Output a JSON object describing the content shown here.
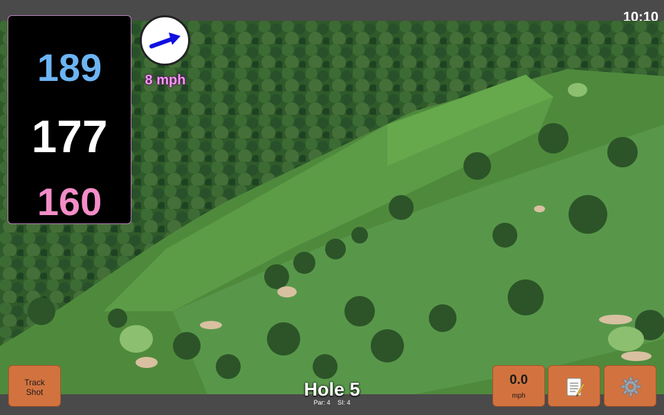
{
  "status_bar": {
    "time": "10:10"
  },
  "distances": {
    "back": "189",
    "middle": "177",
    "front": "160"
  },
  "wind": {
    "speed_label": "8 mph",
    "direction_icon": "arrow-icon",
    "arrow_color": "#1010e0"
  },
  "hole": {
    "title": "Hole 5",
    "par_label": "Par: 4",
    "si_label": "SI: 4"
  },
  "buttons": {
    "track_shot_line1": "Track",
    "track_shot_line2": "Shot",
    "speed_value": "0.0",
    "speed_unit": "mph",
    "notes_icon": "notepad-icon",
    "settings_icon": "gear-icon"
  },
  "colors": {
    "back_distance": "#6cb4f4",
    "middle_distance": "#ffffff",
    "front_distance": "#f48cc8",
    "button_bg": "#d2733f",
    "wind_label": "#ee9af0"
  }
}
